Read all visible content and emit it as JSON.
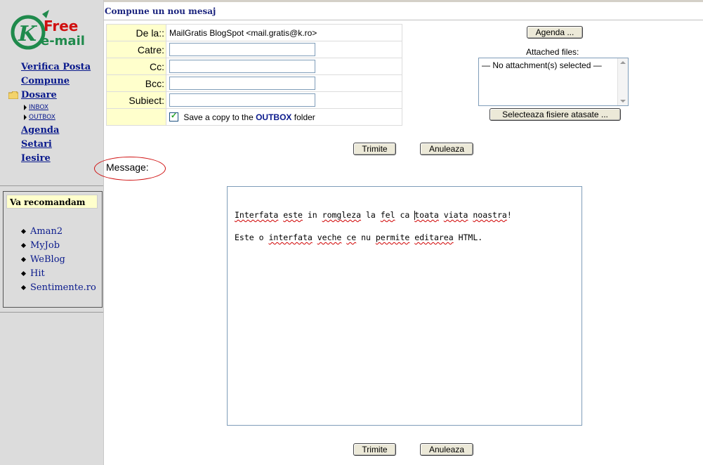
{
  "sidebar": {
    "logo": {
      "line1": "Free",
      "line2": "e-mail",
      "letter": "K"
    },
    "nav_top": [
      "Verifica Posta",
      "Compune"
    ],
    "folders_label": "Dosare",
    "subfolders": [
      "INBOX",
      "OUTBOX"
    ],
    "nav_bottom": [
      "Agenda",
      "Setari",
      "Iesire"
    ],
    "recommend": {
      "title": "Va recomandam",
      "items": [
        "Aman2",
        "MyJob",
        "WeBlog",
        "Hit",
        "Sentimente.ro"
      ]
    }
  },
  "main": {
    "title": "Compune un nou mesaj",
    "form": {
      "from_label": "De la::",
      "from_value": "MailGratis BlogSpot <mail.gratis@k.ro>",
      "to_label": "Catre:",
      "cc_label": "Cc:",
      "bcc_label": "Bcc:",
      "subject_label": "Subiect:",
      "to_value": "",
      "cc_value": "",
      "bcc_value": "",
      "subject_value": "",
      "save_copy_prefix": "Save a copy to the",
      "save_copy_folder": "OUTBOX",
      "save_copy_suffix": "folder",
      "save_copy_checked": true
    },
    "agenda_button": "Agenda ...",
    "attached_label": "Attached files:",
    "attachment_placeholder": "— No attachment(s) selected —",
    "select_attachments_button": "Selecteaza fisiere atasate ...",
    "send_button": "Trimite",
    "cancel_button": "Anuleaza",
    "message_label": "Message:",
    "message_lines": [
      [
        "Interfata",
        " ",
        "este",
        " in ",
        "romgleza",
        " la ",
        "fel",
        " ca ",
        "toata",
        " ",
        "viata",
        " ",
        "noastra",
        "!"
      ],
      [
        "Este",
        " o ",
        "interfata",
        " ",
        "veche",
        " ",
        "ce",
        " nu ",
        "permite",
        " ",
        "editarea",
        " HTML."
      ]
    ]
  },
  "colors": {
    "link": "#0a1a8c",
    "label_bg": "#ffffcc",
    "sidebar_bg": "#dcdcdc",
    "highlight_oval": "#d01010",
    "logo_green": "#1f8a4c",
    "logo_red": "#d01010"
  }
}
